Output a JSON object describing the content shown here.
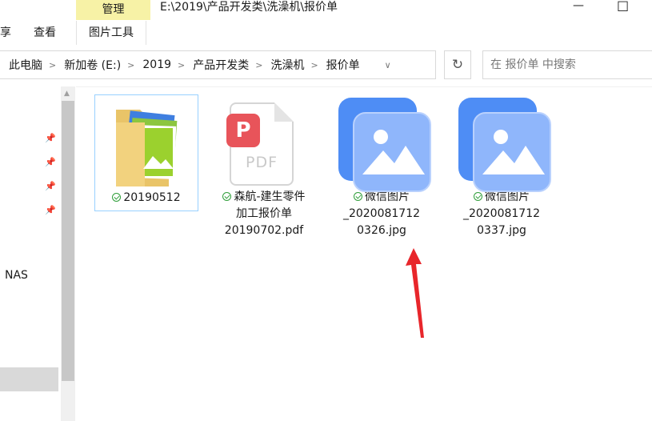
{
  "titlebar": {
    "manage_tab": "管理",
    "path": "E:\\2019\\产品开发类\\洗澡机\\报价单",
    "minimize": "—",
    "maximize": "□"
  },
  "ribbon": {
    "tabs": [
      "享",
      "查看"
    ],
    "active_tab": "图片工具"
  },
  "address": {
    "crumbs": [
      "此电脑",
      "新加卷 (E:)",
      "2019",
      "产品开发类",
      "洗澡机",
      "报价单"
    ],
    "refresh_icon": "↻",
    "search_placeholder": "在 报价单 中搜索"
  },
  "nav": {
    "items": [
      "NAS"
    ]
  },
  "files": [
    {
      "name": "20190512",
      "type": "folder",
      "synced": true,
      "selected": true
    },
    {
      "name_lines": [
        "森航-建生零件",
        "加工报价单",
        "20190702.pdf"
      ],
      "type": "pdf",
      "synced": true,
      "badge": "P",
      "badge_color": "#e8545a",
      "pdf_text": "PDF"
    },
    {
      "name_lines": [
        "微信图片",
        "_2020081712",
        "0326.jpg"
      ],
      "type": "image",
      "synced": true
    },
    {
      "name_lines": [
        "微信图片",
        "_2020081712",
        "0337.jpg"
      ],
      "type": "image",
      "synced": true
    }
  ],
  "colors": {
    "manage_tab_bg": "#f7f2a6",
    "selection_border": "#99d1ff",
    "sync_check": "#2f9e3a",
    "image_icon_back": "#4e8df5",
    "image_icon_front": "#8fb6fb",
    "arrow": "#e8262b"
  }
}
